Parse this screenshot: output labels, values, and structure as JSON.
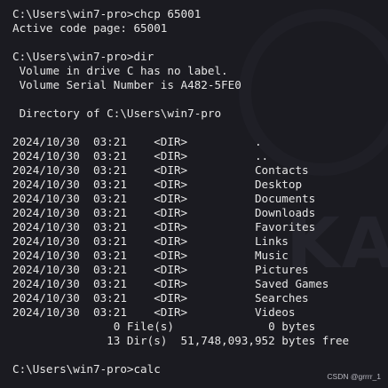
{
  "lines": [
    "C:\\Users\\win7-pro>chcp 65001",
    "Active code page: 65001",
    "",
    "C:\\Users\\win7-pro>dir",
    " Volume in drive C has no label.",
    " Volume Serial Number is A482-5FE0",
    "",
    " Directory of C:\\Users\\win7-pro",
    "",
    "2024/10/30  03:21    <DIR>          .",
    "2024/10/30  03:21    <DIR>          ..",
    "2024/10/30  03:21    <DIR>          Contacts",
    "2024/10/30  03:21    <DIR>          Desktop",
    "2024/10/30  03:21    <DIR>          Documents",
    "2024/10/30  03:21    <DIR>          Downloads",
    "2024/10/30  03:21    <DIR>          Favorites",
    "2024/10/30  03:21    <DIR>          Links",
    "2024/10/30  03:21    <DIR>          Music",
    "2024/10/30  03:21    <DIR>          Pictures",
    "2024/10/30  03:21    <DIR>          Saved Games",
    "2024/10/30  03:21    <DIR>          Searches",
    "2024/10/30  03:21    <DIR>          Videos",
    "               0 File(s)              0 bytes",
    "              13 Dir(s)  51,748,093,952 bytes free",
    "",
    "C:\\Users\\win7-pro>calc"
  ],
  "watermark": "CSDN @grrrr_1"
}
